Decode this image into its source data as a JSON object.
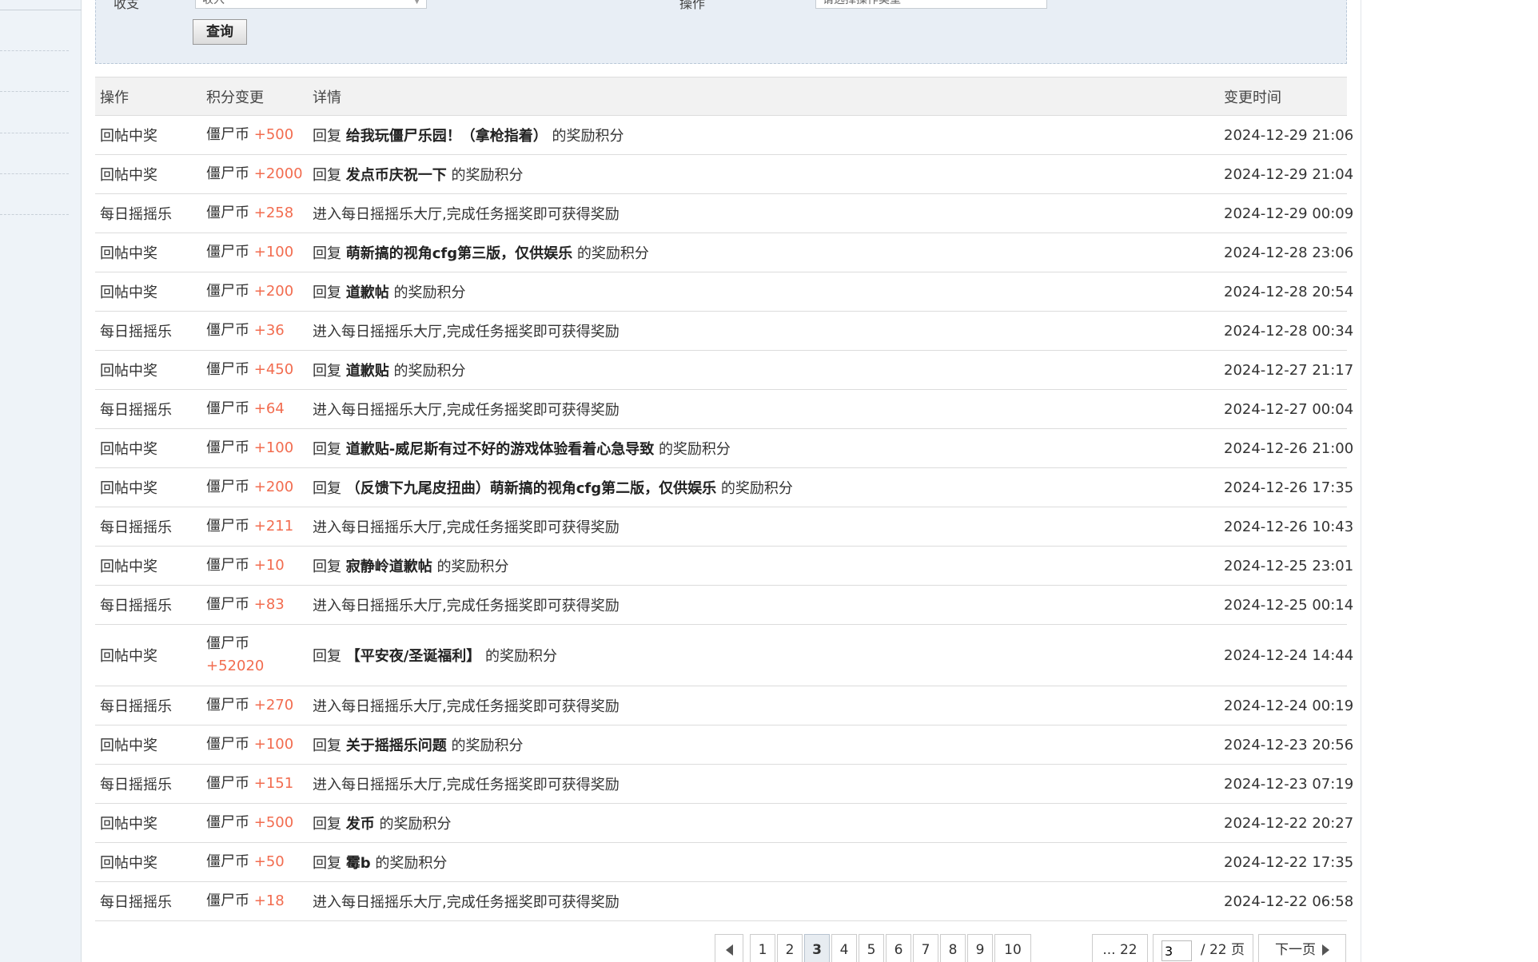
{
  "filter": {
    "field1_label": "收支",
    "field1_value": "收入",
    "field2_label": "操作",
    "field2_value": "请选择操作类型",
    "query_label": "查询"
  },
  "table": {
    "headers": {
      "op": "操作",
      "pts": "积分变更",
      "detail": "详情",
      "time": "变更时间"
    },
    "currency": "僵尸币",
    "rows": [
      {
        "op": "回帖中奖",
        "amount": "+500",
        "prefix": "回复",
        "title": "给我玩僵尸乐园！（拿枪指着）",
        "suffix": "的奖励积分",
        "detail": "",
        "time": "2024-12-29 21:06"
      },
      {
        "op": "回帖中奖",
        "amount": "+2000",
        "prefix": "回复",
        "title": "发点币庆祝一下",
        "suffix": "的奖励积分",
        "detail": "",
        "time": "2024-12-29 21:04"
      },
      {
        "op": "每日摇摇乐",
        "amount": "+258",
        "prefix": "",
        "title": "",
        "suffix": "",
        "detail": "进入每日摇摇乐大厅,完成任务摇奖即可获得奖励",
        "time": "2024-12-29 00:09"
      },
      {
        "op": "回帖中奖",
        "amount": "+100",
        "prefix": "回复",
        "title": "萌新搞的视角cfg第三版，仅供娱乐",
        "suffix": "的奖励积分",
        "detail": "",
        "time": "2024-12-28 23:06"
      },
      {
        "op": "回帖中奖",
        "amount": "+200",
        "prefix": "回复",
        "title": "道歉帖",
        "suffix": "的奖励积分",
        "detail": "",
        "time": "2024-12-28 20:54"
      },
      {
        "op": "每日摇摇乐",
        "amount": "+36",
        "prefix": "",
        "title": "",
        "suffix": "",
        "detail": "进入每日摇摇乐大厅,完成任务摇奖即可获得奖励",
        "time": "2024-12-28 00:34"
      },
      {
        "op": "回帖中奖",
        "amount": "+450",
        "prefix": "回复",
        "title": "道歉贴",
        "suffix": "的奖励积分",
        "detail": "",
        "time": "2024-12-27 21:17"
      },
      {
        "op": "每日摇摇乐",
        "amount": "+64",
        "prefix": "",
        "title": "",
        "suffix": "",
        "detail": "进入每日摇摇乐大厅,完成任务摇奖即可获得奖励",
        "time": "2024-12-27 00:04"
      },
      {
        "op": "回帖中奖",
        "amount": "+100",
        "prefix": "回复",
        "title": "道歉贴-威尼斯有过不好的游戏体验看着心急导致",
        "suffix": "的奖励积分",
        "detail": "",
        "time": "2024-12-26 21:00"
      },
      {
        "op": "回帖中奖",
        "amount": "+200",
        "prefix": "回复",
        "title": "（反馈下九尾皮扭曲）萌新搞的视角cfg第二版，仅供娱乐",
        "suffix": "的奖励积分",
        "detail": "",
        "time": "2024-12-26 17:35"
      },
      {
        "op": "每日摇摇乐",
        "amount": "+211",
        "prefix": "",
        "title": "",
        "suffix": "",
        "detail": "进入每日摇摇乐大厅,完成任务摇奖即可获得奖励",
        "time": "2024-12-26 10:43"
      },
      {
        "op": "回帖中奖",
        "amount": "+10",
        "prefix": "回复",
        "title": "寂静岭道歉帖",
        "suffix": "的奖励积分",
        "detail": "",
        "time": "2024-12-25 23:01"
      },
      {
        "op": "每日摇摇乐",
        "amount": "+83",
        "prefix": "",
        "title": "",
        "suffix": "",
        "detail": "进入每日摇摇乐大厅,完成任务摇奖即可获得奖励",
        "time": "2024-12-25 00:14"
      },
      {
        "op": "回帖中奖",
        "amount": "+52020",
        "prefix": "回复",
        "title": "【平安夜/圣诞福利】",
        "suffix": "的奖励积分",
        "detail": "",
        "time": "2024-12-24 14:44"
      },
      {
        "op": "每日摇摇乐",
        "amount": "+270",
        "prefix": "",
        "title": "",
        "suffix": "",
        "detail": "进入每日摇摇乐大厅,完成任务摇奖即可获得奖励",
        "time": "2024-12-24 00:19"
      },
      {
        "op": "回帖中奖",
        "amount": "+100",
        "prefix": "回复",
        "title": "关于摇摇乐问题",
        "suffix": "的奖励积分",
        "detail": "",
        "time": "2024-12-23 20:56"
      },
      {
        "op": "每日摇摇乐",
        "amount": "+151",
        "prefix": "",
        "title": "",
        "suffix": "",
        "detail": "进入每日摇摇乐大厅,完成任务摇奖即可获得奖励",
        "time": "2024-12-23 07:19"
      },
      {
        "op": "回帖中奖",
        "amount": "+500",
        "prefix": "回复",
        "title": "发币",
        "suffix": "的奖励积分",
        "detail": "",
        "time": "2024-12-22 20:27"
      },
      {
        "op": "回帖中奖",
        "amount": "+50",
        "prefix": "回复",
        "title": "霉b",
        "suffix": "的奖励积分",
        "detail": "",
        "time": "2024-12-22 17:35"
      },
      {
        "op": "每日摇摇乐",
        "amount": "+18",
        "prefix": "",
        "title": "",
        "suffix": "",
        "detail": "进入每日摇摇乐大厅,完成任务摇奖即可获得奖励",
        "time": "2024-12-22 06:58"
      }
    ]
  },
  "pager": {
    "pages": [
      "1",
      "2",
      "3",
      "4",
      "5",
      "6",
      "7",
      "8",
      "9",
      "10"
    ],
    "current": "3",
    "last": "... 22",
    "jump_value": "3",
    "total_label": "/ 22 页",
    "next_label": "下一页"
  },
  "colors": {
    "amount": "#f26c4f",
    "accent_bg": "#e8eef5"
  }
}
